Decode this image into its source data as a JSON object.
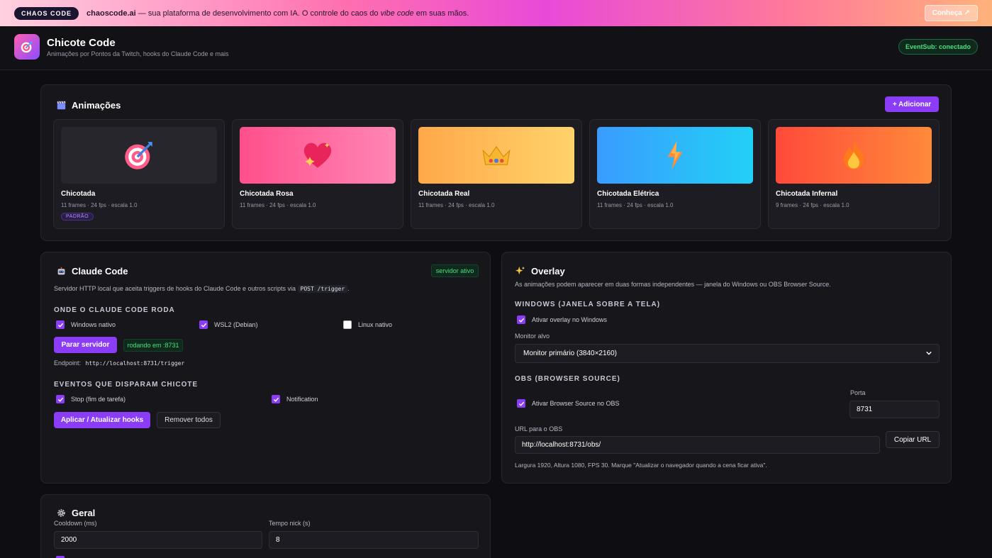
{
  "promo": {
    "badge": "CHAOS CODE",
    "site": "chaoscode.ai",
    "text_before": " — sua plataforma de desenvolvimento com IA. O controle do caos do ",
    "text_italic": "vibe code",
    "text_after": " em suas mãos.",
    "button": "Conheça ↗"
  },
  "header": {
    "title": "Chicote Code",
    "subtitle": "Animações por Pontos da Twitch, hooks do Claude Code e mais",
    "status": "EventSub: conectado"
  },
  "animations": {
    "title": "Animações",
    "add_button": "+ Adicionar",
    "items": [
      {
        "name": "Chicotada",
        "meta": "11 frames · 24 fps · escala 1.0",
        "badge": "PADRÃO",
        "icon": "target-icon"
      },
      {
        "name": "Chicotada Rosa",
        "meta": "11 frames · 24 fps · escala 1.0",
        "icon": "heart-icon"
      },
      {
        "name": "Chicotada Real",
        "meta": "11 frames · 24 fps · escala 1.0",
        "icon": "crown-icon"
      },
      {
        "name": "Chicotada Elétrica",
        "meta": "11 frames · 24 fps · escala 1.0",
        "icon": "lightning-icon"
      },
      {
        "name": "Chicotada Infernal",
        "meta": "9 frames · 24 fps · escala 1.0",
        "icon": "fire-icon"
      }
    ]
  },
  "claude": {
    "title": "Claude Code",
    "status": "servidor ativo",
    "desc_before": "Servidor HTTP local que aceita triggers de hooks do Claude Code e outros scripts via ",
    "desc_code": "POST /trigger",
    "desc_after": ".",
    "where_label": "ONDE O CLAUDE CODE RODA",
    "envs": [
      {
        "label": "Windows nativo",
        "checked": true
      },
      {
        "label": "WSL2 (Debian)",
        "checked": true
      },
      {
        "label": "Linux nativo",
        "checked": false
      }
    ],
    "stop_button": "Parar servidor",
    "running": "rodando em :8731",
    "endpoint_label": "Endpoint:",
    "endpoint": "http://localhost:8731/trigger",
    "events_label": "EVENTOS QUE DISPARAM CHICOTE",
    "events": [
      {
        "label": "Stop (fim de tarefa)",
        "checked": true
      },
      {
        "label": "Notification",
        "checked": true
      }
    ],
    "apply_button": "Aplicar / Atualizar hooks",
    "remove_button": "Remover todos"
  },
  "overlay": {
    "title": "Overlay",
    "desc": "As animações podem aparecer em duas formas independentes — janela do Windows ou OBS Browser Source.",
    "windows_label": "WINDOWS (JANELA SOBRE A TELA)",
    "windows_check": "Ativar overlay no Windows",
    "monitor_label": "Monitor alvo",
    "monitor_value": "Monitor primário (3840×2160)",
    "obs_label": "OBS (BROWSER SOURCE)",
    "obs_check": "Ativar Browser Source no OBS",
    "port_label": "Porta",
    "port_value": "8731",
    "url_label": "URL para o OBS",
    "url_value": "http://localhost:8731/obs/",
    "copy_button": "Copiar URL",
    "note": "Largura 1920, Altura 1080, FPS 30. Marque \"Atualizar o navegador quando a cena ficar ativa\"."
  },
  "geral": {
    "title": "Geral",
    "cooldown_label": "Cooldown (ms)",
    "cooldown_value": "2000",
    "nick_label": "Tempo nick (s)",
    "nick_value": "8"
  }
}
